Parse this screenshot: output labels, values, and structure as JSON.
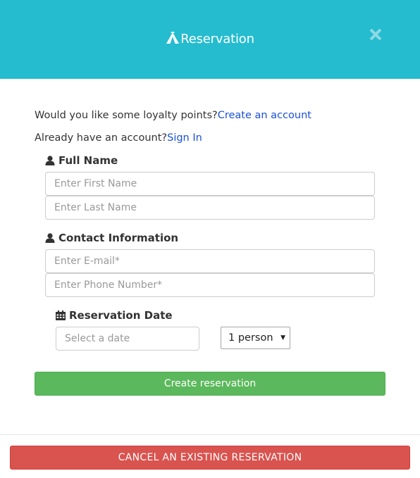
{
  "header": {
    "title": "Reservation",
    "icon": "tent-icon",
    "background_color": "#25bcd0"
  },
  "links": {
    "loyalty_prompt": "Would you like some loyalty points?",
    "create_account": "Create an account",
    "account_prompt": "Already have an account?",
    "sign_in": "Sign In"
  },
  "full_name": {
    "label": "Full Name",
    "first_name_placeholder": "Enter First Name",
    "last_name_placeholder": "Enter Last Name"
  },
  "contact": {
    "label": "Contact Information",
    "email_placeholder": "Enter E-mail*",
    "phone_placeholder": "Enter Phone Number*"
  },
  "reservation_date": {
    "label": "Reservation Date",
    "date_placeholder": "Select a date",
    "party_size": "1 person"
  },
  "actions": {
    "create_label": "Create reservation",
    "create_color": "#5cb85c",
    "cancel_label": "CANCEL AN EXISTING RESERVATION",
    "cancel_color": "#d9534f"
  }
}
